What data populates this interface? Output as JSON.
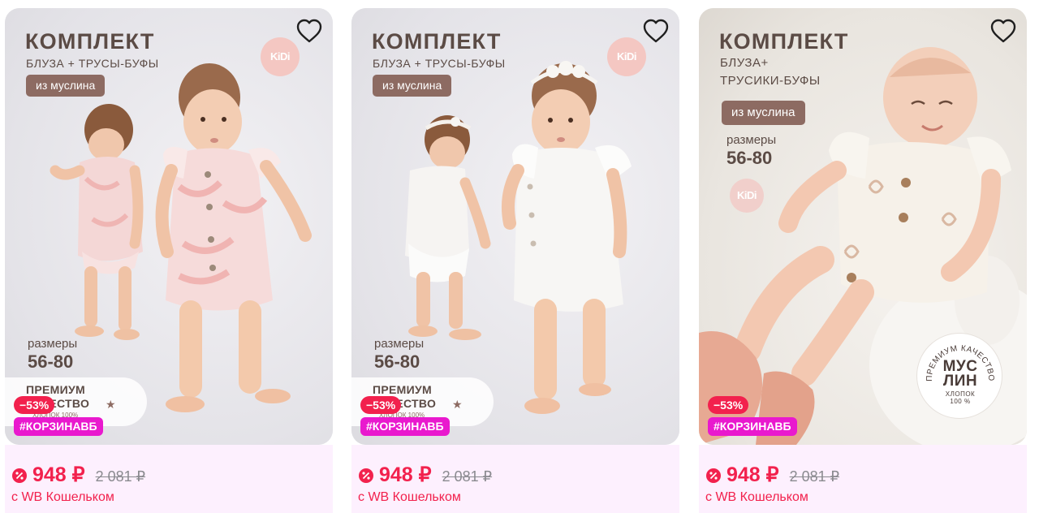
{
  "cards": [
    {
      "title": "КОМПЛЕКТ",
      "subtitle": "БЛУЗА + ТРУСЫ-БУФЫ",
      "material": "из муслина",
      "sizes_label": "размеры",
      "sizes_value": "56-80",
      "logo_text": "KiDi",
      "premium_text": "ПРЕМИУМ\nКАЧЕСТВО",
      "premium_small": "ХЛОПОК 100%",
      "discount": "−53%",
      "tag": "#КОРЗИНАВБ",
      "price": "948 ₽",
      "old_price": "2 081 ₽",
      "wallet": "с WB Кошельком"
    },
    {
      "title": "КОМПЛЕКТ",
      "subtitle": "БЛУЗА + ТРУСЫ-БУФЫ",
      "material": "из муслина",
      "sizes_label": "размеры",
      "sizes_value": "56-80",
      "logo_text": "KiDi",
      "premium_text": "ПРЕМИУМ\nКАЧЕСТВО",
      "premium_small": "ХЛОПОК 100%",
      "discount": "−53%",
      "tag": "#КОРЗИНАВБ",
      "price": "948 ₽",
      "old_price": "2 081 ₽",
      "wallet": "с WB Кошельком"
    },
    {
      "title": "КОМПЛЕКТ",
      "subtitle": "БЛУЗА+\nТРУСИКИ-БУФЫ",
      "material": "из муслина",
      "sizes_label": "размеры",
      "sizes_value": "56-80",
      "logo_text": "KiDi",
      "muslin_arc": "ПРЕМИУМ КАЧЕСТВО",
      "muslin_main": "МУС\nЛИН",
      "muslin_sub": "ХЛОПОК\n100 %",
      "discount": "−53%",
      "tag": "#КОРЗИНАВБ",
      "price": "948 ₽",
      "old_price": "2 081 ₽",
      "wallet": "с WB Кошельком"
    }
  ],
  "colors": {
    "brand_text": "#5b4b45",
    "material_pill": "#8d6b62",
    "price_red": "#f2214d",
    "tag_magenta": "#e919ce",
    "price_area_bg": "#fdf0fe"
  },
  "icons": {
    "favorite": "heart-outline-icon",
    "price_badge": "percent-tag-icon"
  }
}
